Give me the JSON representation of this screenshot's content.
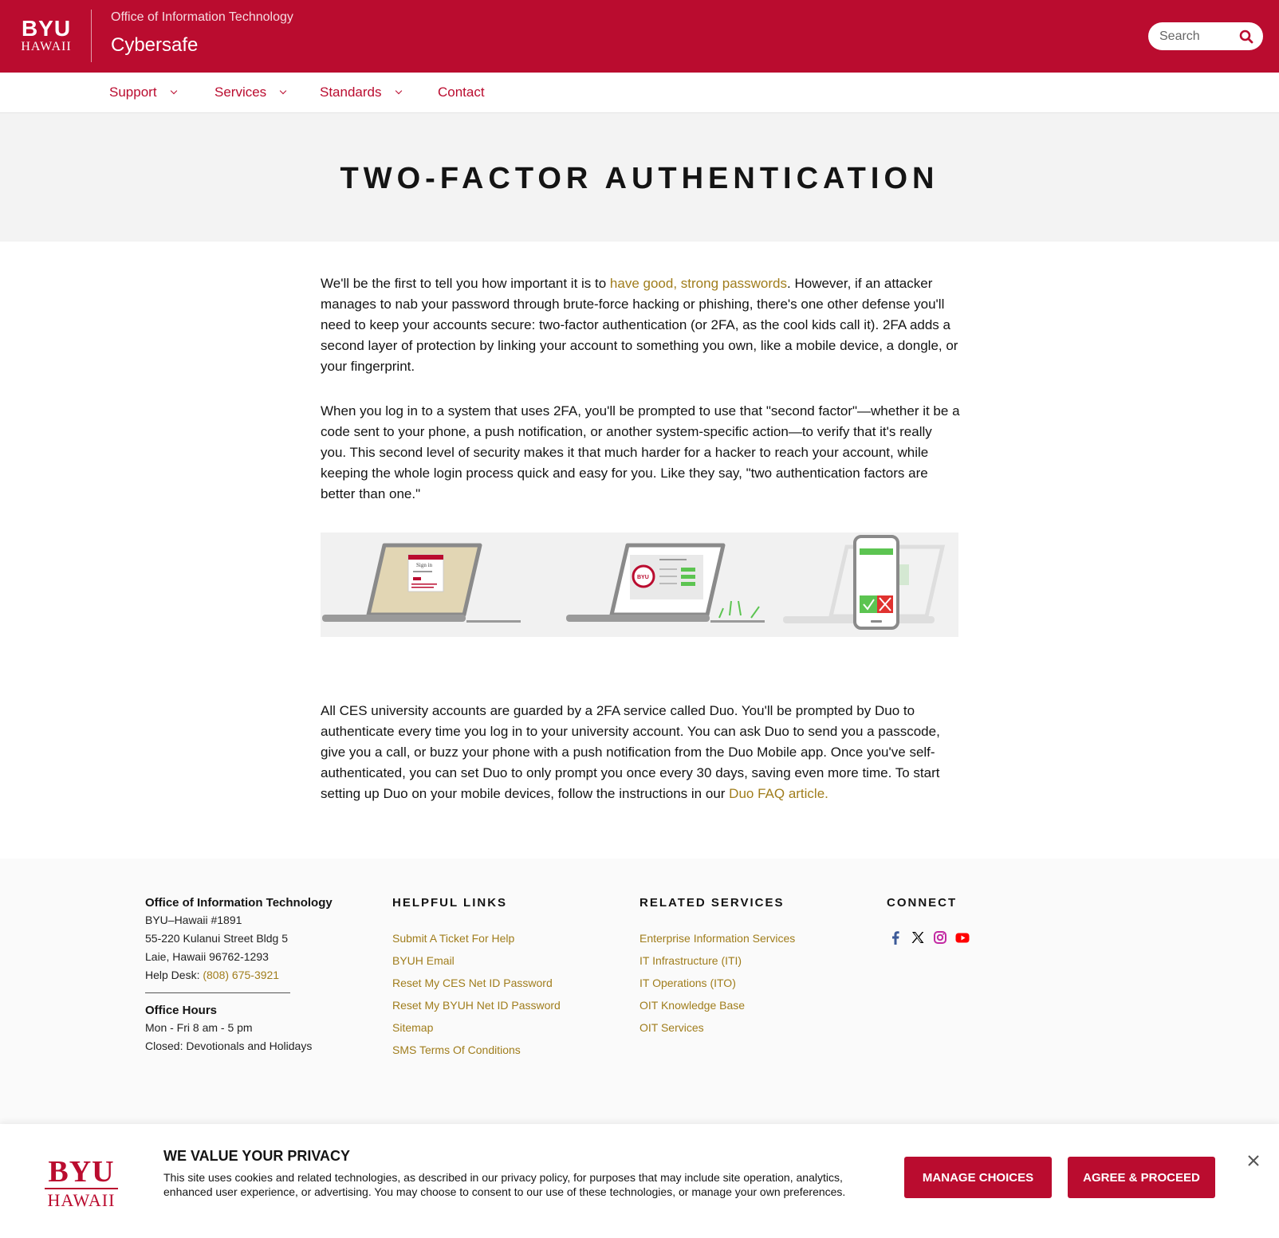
{
  "header": {
    "logo_top": "BYU",
    "logo_bottom": "HAWAII",
    "subtitle": "Office of Information Technology",
    "title": "Cybersafe",
    "search_placeholder": "Search",
    "search_icon": "search-icon"
  },
  "nav": {
    "items": [
      {
        "label": "Support",
        "has_dropdown": true
      },
      {
        "label": "Services",
        "has_dropdown": true
      },
      {
        "label": "Standards",
        "has_dropdown": true
      },
      {
        "label": "Contact",
        "has_dropdown": false
      }
    ]
  },
  "page": {
    "heading": "TWO-FACTOR AUTHENTICATION",
    "p1_before": "We'll be the first to tell you how important it is to ",
    "p1_link": "have good, strong passwords",
    "p1_after": ". However, if an attacker manages to nab your password through brute-force hacking or phishing, there's one other defense you'll need to keep your accounts secure: two-factor authentication (or 2FA, as the cool kids call it). 2FA adds a second layer of protection by linking your account to something you own, like a mobile device, a dongle, or your fingerprint.",
    "p2": "When you log in to a system that uses 2FA, you'll be prompted to use that \"second factor\"—whether it be a code sent to your phone, a push notification, or another system-specific action—to verify that it's really you. This second level of security makes it that much harder for a hacker to reach your account, while keeping the whole login process quick and easy for you. Like they say, \"two authentication factors are better than one.\"",
    "illus_signin": "Sign in",
    "illus_badge": "BYU",
    "p3_before": "All CES university accounts are guarded by a 2FA service called Duo. You'll be prompted by Duo to authenticate every time you log in to your university account. You can ask Duo to send you a passcode, give you a call, or buzz your phone with a push notification from the Duo Mobile app. Once you've self-authenticated, you can set Duo to only prompt you once every 30 days, saving even more time. To start setting up Duo on your mobile devices, follow the instructions in our ",
    "p3_link": "Duo FAQ article."
  },
  "footer": {
    "org": "Office of Information Technology",
    "address": [
      "BYU–Hawaii #1891",
      "55-220 Kulanui Street Bldg 5",
      "Laie, Hawaii 96762-1293"
    ],
    "helpdesk_label": "Help Desk: ",
    "helpdesk_phone": "(808) 675-3921",
    "hours_title": "Office Hours",
    "hours": [
      "Mon - Fri 8 am - 5 pm",
      "Closed: Devotionals and Holidays"
    ],
    "helpful_title": "HELPFUL LINKS",
    "helpful_links": [
      "Submit A Ticket For Help",
      "BYUH Email",
      "Reset My CES Net ID Password",
      "Reset My BYUH Net ID Password",
      "Sitemap",
      "SMS Terms Of Conditions"
    ],
    "related_title": "RELATED SERVICES",
    "related_links": [
      "Enterprise Information Services",
      "IT Infrastructure (ITI)",
      "IT Operations (ITO)",
      "OIT Knowledge Base",
      "OIT Services"
    ],
    "connect_title": "CONNECT",
    "social_icons": [
      "facebook-icon",
      "x-icon",
      "instagram-icon",
      "youtube-icon"
    ]
  },
  "cookie": {
    "logo_top": "BYU",
    "logo_bottom": "HAWAII",
    "title": "WE VALUE YOUR PRIVACY",
    "text": "This site uses cookies and related technologies, as described in our privacy policy, for purposes that may include site operation, analytics, enhanced user experience, or advertising. You may choose to consent to our use of these technologies, or manage your own preferences.",
    "manage_label": "MANAGE CHOICES",
    "agree_label": "AGREE & PROCEED",
    "close_icon": "close-icon"
  },
  "colors": {
    "brand": "#ba0c2f",
    "link": "#a07d1c",
    "success": "#5cc451"
  }
}
